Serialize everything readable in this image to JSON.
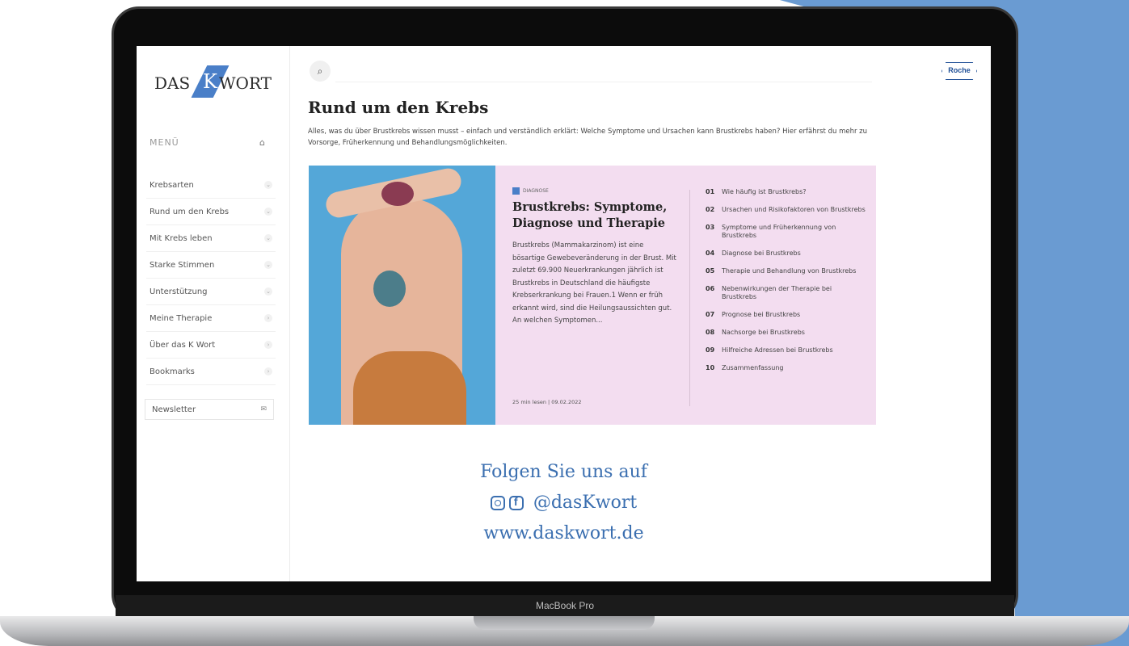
{
  "device": {
    "label": "MacBook Pro"
  },
  "brand": {
    "logo_part1": "DAS",
    "logo_k": "K",
    "logo_part2": "WORT",
    "partner": "Roche"
  },
  "sidebar": {
    "menu_heading": "MENÜ",
    "items": [
      {
        "label": "Krebsarten",
        "chevron": "⌄"
      },
      {
        "label": "Rund um den Krebs",
        "chevron": "⌄"
      },
      {
        "label": "Mit Krebs leben",
        "chevron": "⌄"
      },
      {
        "label": "Starke Stimmen",
        "chevron": "⌄"
      },
      {
        "label": "Unterstützung",
        "chevron": "⌄"
      },
      {
        "label": "Meine Therapie",
        "chevron": "›"
      },
      {
        "label": "Über das K Wort",
        "chevron": "›"
      },
      {
        "label": "Bookmarks",
        "chevron": "›"
      }
    ],
    "newsletter_label": "Newsletter"
  },
  "main": {
    "title": "Rund um den Krebs",
    "intro": "Alles, was du über Brustkrebs wissen musst – einfach und verständlich erklärt: Welche Symptome und Ursachen kann Brustkrebs haben? Hier erfährst du mehr zu Vorsorge, Früherkennung und Behandlungsmöglichkeiten.",
    "card": {
      "badge": "DIAGNOSE",
      "title": "Brustkrebs: Symptome, Diagnose und Therapie",
      "description": "Brustkrebs (Mammakarzinom) ist eine bösartige Gewebeveränderung in der Brust. Mit zuletzt 69.900 Neuerkrankungen jährlich ist Brustkrebs in Deutschland die häufigste Krebserkrankung bei Frauen.1 Wenn er früh erkannt wird, sind die Heilungsaussichten gut. An welchen Symptomen...",
      "meta": "25 min lesen | 09.02.2022",
      "toc": [
        {
          "num": "01",
          "text": "Wie häufig ist Brustkrebs?"
        },
        {
          "num": "02",
          "text": "Ursachen und Risikofaktoren von Brustkrebs"
        },
        {
          "num": "03",
          "text": "Symptome und Früherkennung von Brustkrebs"
        },
        {
          "num": "04",
          "text": "Diagnose bei Brustkrebs"
        },
        {
          "num": "05",
          "text": "Therapie und Behandlung von Brustkrebs"
        },
        {
          "num": "06",
          "text": "Nebenwirkungen der Therapie bei Brustkrebs"
        },
        {
          "num": "07",
          "text": "Prognose bei Brustkrebs"
        },
        {
          "num": "08",
          "text": "Nachsorge bei Brustkrebs"
        },
        {
          "num": "09",
          "text": "Hilfreiche Adressen bei Brustkrebs"
        },
        {
          "num": "10",
          "text": "Zusammenfassung"
        }
      ]
    }
  },
  "footer": {
    "follow_line": "Folgen Sie uns auf",
    "handle": "@dasKwort",
    "website": "www.daskwort.de"
  },
  "colors": {
    "accent_blue": "#4a7fc8",
    "card_bg": "#f3ddf0",
    "background_brush": "#6a9bd2"
  }
}
